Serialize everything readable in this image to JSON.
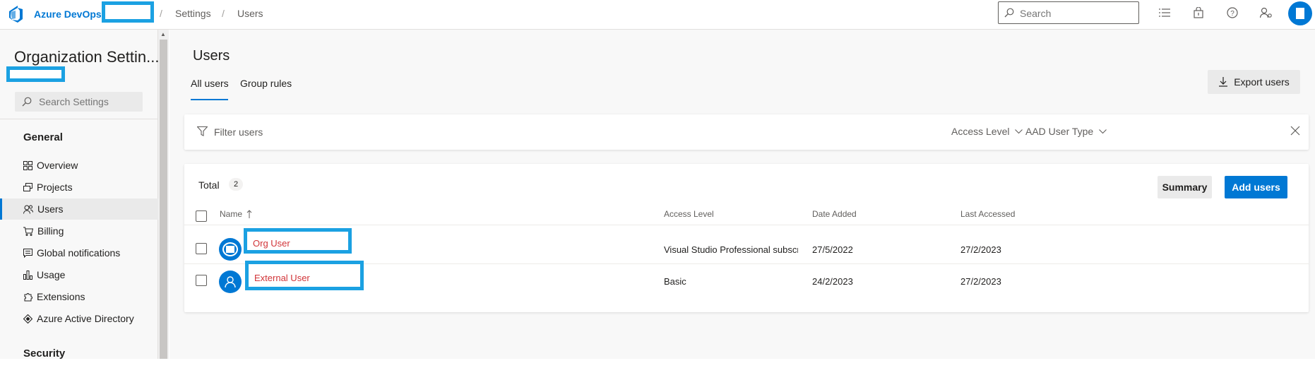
{
  "topbar": {
    "brand": "Azure DevOps",
    "breadcrumb_sep": "/",
    "breadcrumb_settings": "Settings",
    "breadcrumb_users": "Users",
    "search_placeholder": "Search"
  },
  "sidebar": {
    "title": "Organization Settin...",
    "search_placeholder": "Search Settings",
    "section_general": "General",
    "items": [
      {
        "label": "Overview",
        "icon": "overview-icon"
      },
      {
        "label": "Projects",
        "icon": "projects-icon"
      },
      {
        "label": "Users",
        "icon": "users-icon",
        "active": true
      },
      {
        "label": "Billing",
        "icon": "cart-icon"
      },
      {
        "label": "Global notifications",
        "icon": "notifications-icon"
      },
      {
        "label": "Usage",
        "icon": "usage-icon"
      },
      {
        "label": "Extensions",
        "icon": "extensions-icon"
      },
      {
        "label": "Azure Active Directory",
        "icon": "aad-icon"
      }
    ],
    "section_security": "Security"
  },
  "main": {
    "title": "Users",
    "tabs": [
      {
        "label": "All users",
        "selected": true
      },
      {
        "label": "Group rules",
        "selected": false
      }
    ],
    "export_label": "Export users",
    "filter": {
      "placeholder": "Filter users",
      "access_level": "Access Level",
      "aad_user_type": "AAD User Type"
    },
    "total_label": "Total",
    "total_count": "2",
    "summary_label": "Summary",
    "add_users_label": "Add users",
    "columns": [
      "Name",
      "Access Level",
      "Date Added",
      "Last Accessed"
    ],
    "rows": [
      {
        "name": "Org User",
        "access_level": "Visual Studio Professional subscriptic",
        "date_added": "27/5/2022",
        "last_accessed": "27/2/2023"
      },
      {
        "name": "External User",
        "access_level": "Basic",
        "date_added": "24/2/2023",
        "last_accessed": "27/2/2023"
      }
    ]
  },
  "colors": {
    "accent": "#0078d4",
    "highlight_box": "#1ba1e2",
    "name_text": "#d13438"
  }
}
